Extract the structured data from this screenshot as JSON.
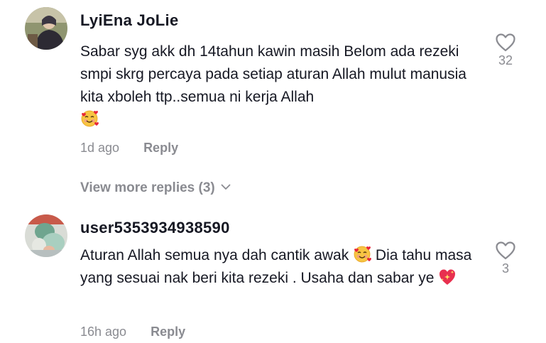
{
  "comments": [
    {
      "username": "LyiEna JoLie",
      "text": "Sabar syg akk dh 14tahun kawin masih Belom ada rezeki smpi skrg percaya pada setiap aturan Allah mulut manusia kita xboleh ttp..semua ni kerja Allah",
      "time": "1d ago",
      "reply_label": "Reply",
      "likes": "32",
      "avatar_icon": "profile-photo",
      "emoji_icon": "smiling-face-with-hearts-emoji"
    },
    {
      "username": "user5353934938590",
      "text_part1": "Aturan Allah semua nya dah cantik awak",
      "text_part2": "Dia tahu masa yang sesuai nak beri kita rezeki . Usaha dan sabar ye",
      "time": "16h ago",
      "reply_label": "Reply",
      "likes": "3",
      "avatar_icon": "profile-photo",
      "emoji_icons": [
        "smiling-face-with-hearts-emoji",
        "sparkling-heart-emoji"
      ]
    }
  ],
  "view_more": {
    "label": "View more replies (3)",
    "icon": "chevron-down-icon"
  },
  "colors": {
    "text": "#161823",
    "secondary": "#8a8b91",
    "heart_outline": "#8a8b91"
  }
}
